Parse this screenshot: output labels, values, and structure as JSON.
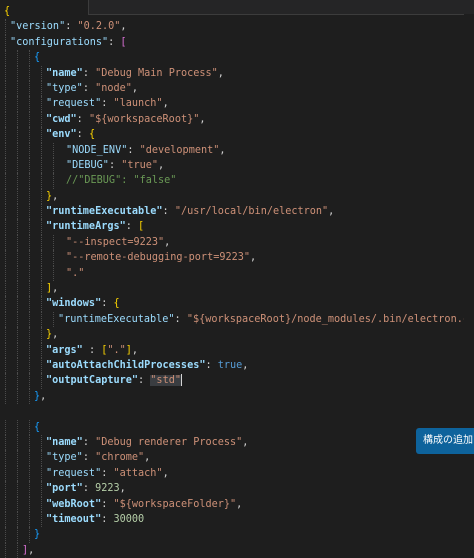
{
  "editor": {
    "language": "json",
    "lines": [
      [
        {
          "t": "{",
          "c": "brace"
        }
      ],
      [
        {
          "t": "\"version\"",
          "c": "key"
        },
        {
          "t": ": ",
          "c": "punct"
        },
        {
          "t": "\"0.2.0\"",
          "c": "str"
        },
        {
          "t": ",",
          "c": "punct"
        }
      ],
      [
        {
          "t": "\"configurations\"",
          "c": "key"
        },
        {
          "t": ": ",
          "c": "punct"
        },
        {
          "t": "[",
          "c": "bracket"
        }
      ],
      [
        {
          "t": "{",
          "c": "brace2"
        }
      ],
      [
        {
          "t": "\"name\"",
          "c": "key-bold"
        },
        {
          "t": ": ",
          "c": "punct"
        },
        {
          "t": "\"Debug Main Process\"",
          "c": "str"
        },
        {
          "t": ",",
          "c": "punct"
        }
      ],
      [
        {
          "t": "\"type\"",
          "c": "key"
        },
        {
          "t": ": ",
          "c": "punct"
        },
        {
          "t": "\"node\"",
          "c": "str"
        },
        {
          "t": ",",
          "c": "punct"
        }
      ],
      [
        {
          "t": "\"request\"",
          "c": "key"
        },
        {
          "t": ": ",
          "c": "punct"
        },
        {
          "t": "\"launch\"",
          "c": "str"
        },
        {
          "t": ",",
          "c": "punct"
        }
      ],
      [
        {
          "t": "\"cwd\"",
          "c": "key-bold"
        },
        {
          "t": ": ",
          "c": "punct"
        },
        {
          "t": "\"${workspaceRoot}\"",
          "c": "str"
        },
        {
          "t": ",",
          "c": "punct"
        }
      ],
      [
        {
          "t": "\"env\"",
          "c": "key-bold"
        },
        {
          "t": ": ",
          "c": "punct"
        },
        {
          "t": "{",
          "c": "brace"
        }
      ],
      [
        {
          "t": "\"NODE_ENV\"",
          "c": "key"
        },
        {
          "t": ": ",
          "c": "punct"
        },
        {
          "t": "\"development\"",
          "c": "str"
        },
        {
          "t": ",",
          "c": "punct"
        }
      ],
      [
        {
          "t": "\"DEBUG\"",
          "c": "key"
        },
        {
          "t": ": ",
          "c": "punct"
        },
        {
          "t": "\"true\"",
          "c": "str"
        },
        {
          "t": ",",
          "c": "punct"
        }
      ],
      [
        {
          "t": "//\"DEBUG\": \"false\"",
          "c": "comment"
        }
      ],
      [
        {
          "t": "}",
          "c": "brace"
        },
        {
          "t": ",",
          "c": "punct"
        }
      ],
      [
        {
          "t": "\"runtimeExecutable\"",
          "c": "key-bold"
        },
        {
          "t": ": ",
          "c": "punct"
        },
        {
          "t": "\"/usr/local/bin/electron\"",
          "c": "str"
        },
        {
          "t": ",",
          "c": "punct"
        }
      ],
      [
        {
          "t": "\"runtimeArgs\"",
          "c": "key-bold"
        },
        {
          "t": ": ",
          "c": "punct"
        },
        {
          "t": "[",
          "c": "brace"
        }
      ],
      [
        {
          "t": "\"--inspect=9223\"",
          "c": "str"
        },
        {
          "t": ",",
          "c": "punct"
        }
      ],
      [
        {
          "t": "\"--remote-debugging-port=9223\"",
          "c": "str"
        },
        {
          "t": ",",
          "c": "punct"
        }
      ],
      [
        {
          "t": "\".\"",
          "c": "str"
        }
      ],
      [
        {
          "t": "]",
          "c": "brace"
        },
        {
          "t": ",",
          "c": "punct"
        }
      ],
      [
        {
          "t": "\"windows\"",
          "c": "key-bold"
        },
        {
          "t": ": ",
          "c": "punct"
        },
        {
          "t": "{",
          "c": "brace"
        }
      ],
      [
        {
          "t": "\"runtimeExecutable\"",
          "c": "key"
        },
        {
          "t": ": ",
          "c": "punct"
        },
        {
          "t": "\"${workspaceRoot}/node_modules/.bin/electron.cmd\"",
          "c": "str"
        }
      ],
      [
        {
          "t": "}",
          "c": "brace"
        },
        {
          "t": ",",
          "c": "punct"
        }
      ],
      [
        {
          "t": "\"args\"",
          "c": "key-bold"
        },
        {
          "t": " : ",
          "c": "punct"
        },
        {
          "t": "[",
          "c": "brace"
        },
        {
          "t": "\".\"",
          "c": "str"
        },
        {
          "t": "]",
          "c": "brace"
        },
        {
          "t": ",",
          "c": "punct"
        }
      ],
      [
        {
          "t": "\"autoAttachChildProcesses\"",
          "c": "key-bold"
        },
        {
          "t": ": ",
          "c": "punct"
        },
        {
          "t": "true",
          "c": "bool"
        },
        {
          "t": ",",
          "c": "punct"
        }
      ],
      [
        {
          "t": "\"outputCapture\"",
          "c": "key-bold"
        },
        {
          "t": ": ",
          "c": "punct"
        },
        {
          "t": "\"std\"",
          "c": "str-hl"
        },
        {
          "t": "",
          "c": "cursor"
        }
      ],
      [
        {
          "t": "}",
          "c": "brace2"
        },
        {
          "t": ",",
          "c": "punct"
        }
      ],
      [],
      [
        {
          "t": "{",
          "c": "brace2"
        }
      ],
      [
        {
          "t": "\"name\"",
          "c": "key-bold"
        },
        {
          "t": ": ",
          "c": "punct"
        },
        {
          "t": "\"Debug renderer Process\"",
          "c": "str"
        },
        {
          "t": ",",
          "c": "punct"
        }
      ],
      [
        {
          "t": "\"type\"",
          "c": "key"
        },
        {
          "t": ": ",
          "c": "punct"
        },
        {
          "t": "\"chrome\"",
          "c": "str"
        },
        {
          "t": ",",
          "c": "punct"
        }
      ],
      [
        {
          "t": "\"request\"",
          "c": "key"
        },
        {
          "t": ": ",
          "c": "punct"
        },
        {
          "t": "\"attach\"",
          "c": "str"
        },
        {
          "t": ",",
          "c": "punct"
        }
      ],
      [
        {
          "t": "\"port\"",
          "c": "key-bold"
        },
        {
          "t": ": ",
          "c": "punct"
        },
        {
          "t": "9223",
          "c": "num"
        },
        {
          "t": ",",
          "c": "punct"
        }
      ],
      [
        {
          "t": "\"webRoot\"",
          "c": "key-bold"
        },
        {
          "t": ": ",
          "c": "punct"
        },
        {
          "t": "\"${workspaceFolder}\"",
          "c": "str"
        },
        {
          "t": ",",
          "c": "punct"
        }
      ],
      [
        {
          "t": "\"timeout\"",
          "c": "key-bold"
        },
        {
          "t": ": ",
          "c": "punct"
        },
        {
          "t": "30000",
          "c": "num"
        }
      ],
      [
        {
          "t": "}",
          "c": "brace2"
        }
      ],
      [
        {
          "t": "]",
          "c": "bracket"
        },
        {
          "t": ",",
          "c": "punct"
        }
      ]
    ]
  },
  "toast": {
    "label": "構成の追加..."
  },
  "colors": {
    "background": "#1e1e1e",
    "key": "#9cdcfe",
    "string": "#ce9178",
    "boolean": "#569cd6",
    "number": "#b5cea8",
    "comment": "#6a9955",
    "bracket_gold": "#ffd700",
    "bracket_orchid": "#da70d6",
    "bracket_blue": "#179fff",
    "toast_bg": "#0e639c"
  }
}
